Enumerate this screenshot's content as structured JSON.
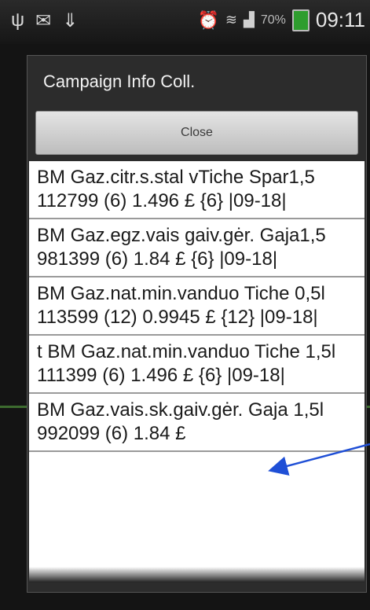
{
  "status_bar": {
    "left_icons": [
      "usb-icon",
      "mail-icon",
      "download-icon"
    ],
    "battery_percent": "70%",
    "time": "09:11",
    "right_icons": [
      "alarm-icon",
      "wifi-icon",
      "signal-icon",
      "battery-icon"
    ]
  },
  "dialog": {
    "title": "Campaign Info Coll.",
    "close_label": "Close",
    "items": [
      "BM Gaz.citr.s.stal vTiche Spar1,5 112799 (6) 1.496 £ {6} |09-18|",
      "BM Gaz.egz.vais gaiv.gėr. Gaja1,5 981399 (6) 1.84 £ {6} |09-18|",
      "BM Gaz.nat.min.vanduo Tiche 0,5l 113599 (12) 0.9945 £ {12} |09-18|",
      "t BM Gaz.nat.min.vanduo Tiche 1,5l 111399 (6) 1.496 £ {6} |09-18|",
      "BM Gaz.vais.sk.gaiv.gėr. Gaja 1,5l 992099 (6) 1.84 £"
    ]
  },
  "annotation_color": "#1f4fd6",
  "accent_colors": {
    "battery": "#2e9d2e",
    "stripe": "#3d6b2f"
  }
}
